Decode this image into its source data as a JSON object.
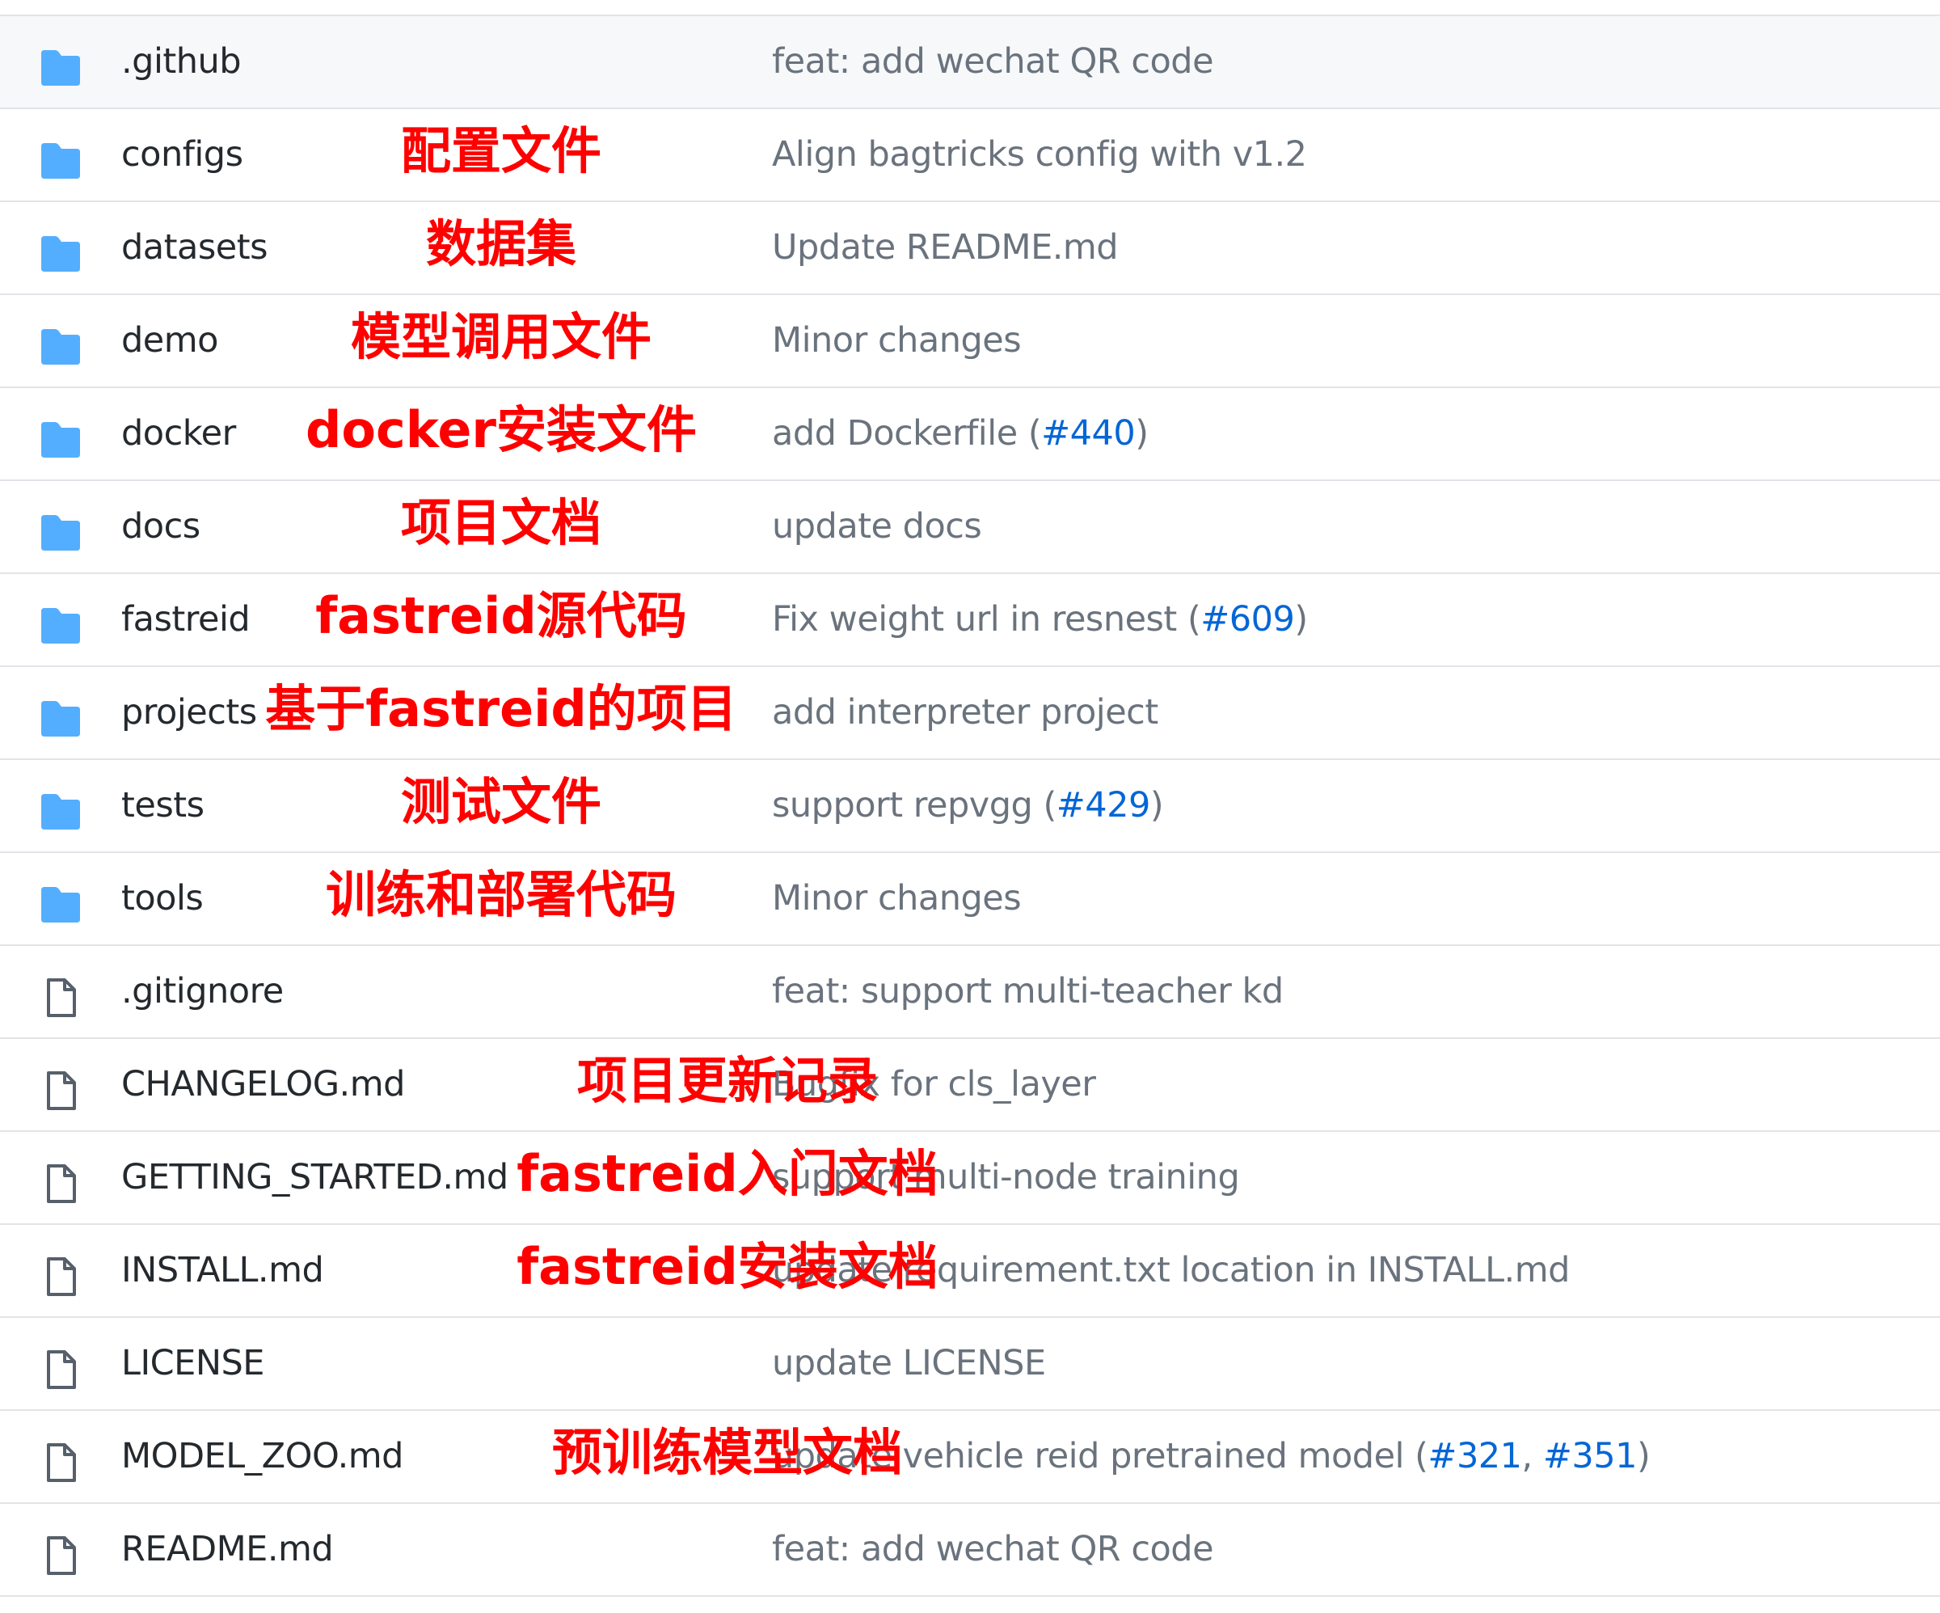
{
  "colors": {
    "folder": "#54aeff",
    "file_icon": "#57606a",
    "text": "#24292e",
    "muted": "#6a737d",
    "link": "#0366d6",
    "annotation": "#ff0000",
    "border": "#e1e4e8"
  },
  "rows": [
    {
      "type": "folder",
      "icon": "folder-icon",
      "name": ".github",
      "message": "feat: add wechat QR code",
      "annotation": ""
    },
    {
      "type": "folder",
      "icon": "folder-icon",
      "name": "configs",
      "message": "Align bagtricks config with v1.2",
      "annotation": "配置文件"
    },
    {
      "type": "folder",
      "icon": "folder-icon",
      "name": "datasets",
      "message": "Update README.md",
      "annotation": "数据集"
    },
    {
      "type": "folder",
      "icon": "folder-icon",
      "name": "demo",
      "message": "Minor changes",
      "annotation": "模型调用文件"
    },
    {
      "type": "folder",
      "icon": "folder-icon",
      "name": "docker",
      "message": "add Dockerfile (",
      "pr": "#440",
      "message_end": ")",
      "annotation": "docker安装文件"
    },
    {
      "type": "folder",
      "icon": "folder-icon",
      "name": "docs",
      "message": "update docs",
      "annotation": "项目文档"
    },
    {
      "type": "folder",
      "icon": "folder-icon",
      "name": "fastreid",
      "message": "Fix weight url in resnest (",
      "pr": "#609",
      "message_end": ")",
      "annotation": "fastreid源代码"
    },
    {
      "type": "folder",
      "icon": "folder-icon",
      "name": "projects",
      "message": "add interpreter project",
      "annotation": "基于fastreid的项目"
    },
    {
      "type": "folder",
      "icon": "folder-icon",
      "name": "tests",
      "message": "support repvgg (",
      "pr": "#429",
      "message_end": ")",
      "annotation": "测试文件"
    },
    {
      "type": "folder",
      "icon": "folder-icon",
      "name": "tools",
      "message": "Minor changes",
      "annotation": "训练和部署代码"
    },
    {
      "type": "file",
      "icon": "file-icon",
      "name": ".gitignore",
      "message": "feat: support multi-teacher kd",
      "annotation": ""
    },
    {
      "type": "file",
      "icon": "file-icon",
      "name": "CHANGELOG.md",
      "message": "Bugfix for cls_layer",
      "annotation": "项目更新记录"
    },
    {
      "type": "file",
      "icon": "file-icon",
      "name": "GETTING_STARTED.md",
      "message": "support multi-node training",
      "annotation": "fastreid入门文档"
    },
    {
      "type": "file",
      "icon": "file-icon",
      "name": "INSTALL.md",
      "message": "update requirement.txt location in INSTALL.md",
      "annotation": "fastreid安装文档"
    },
    {
      "type": "file",
      "icon": "file-icon",
      "name": "LICENSE",
      "message": "update LICENSE",
      "annotation": ""
    },
    {
      "type": "file",
      "icon": "file-icon",
      "name": "MODEL_ZOO.md",
      "message": "update vehicle reid pretrained model (",
      "pr": "#321",
      "message_mid": ", ",
      "pr2": "#351",
      "message_end": ")",
      "annotation": "预训练模型文档"
    },
    {
      "type": "file",
      "icon": "file-icon",
      "name": "README.md",
      "message": "feat: add wechat QR code",
      "annotation": ""
    }
  ]
}
